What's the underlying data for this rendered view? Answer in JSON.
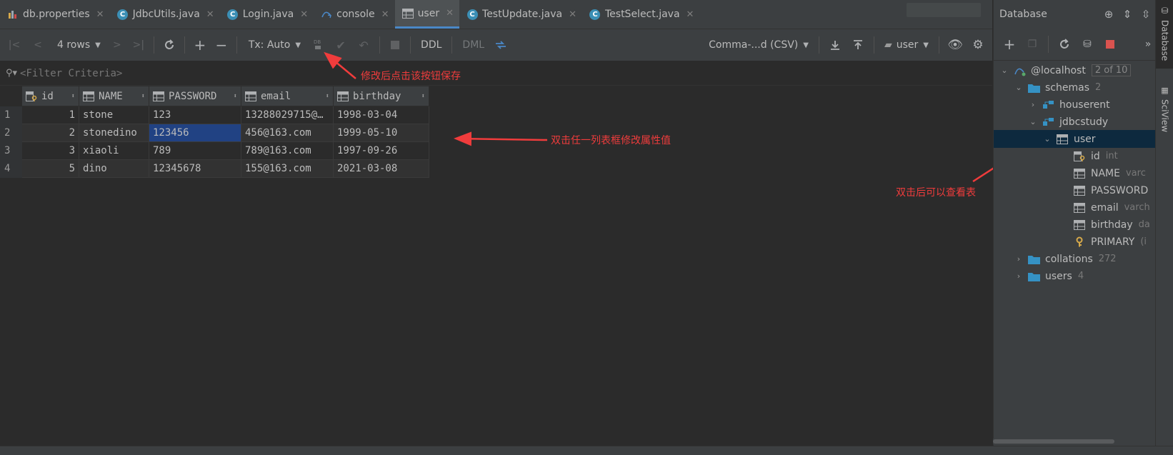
{
  "tabs": [
    {
      "label": "db.properties",
      "icon": "properties-file-icon",
      "active": false
    },
    {
      "label": "JdbcUtils.java",
      "icon": "java-class-icon",
      "active": false
    },
    {
      "label": "Login.java",
      "icon": "java-class-icon",
      "active": false
    },
    {
      "label": "console",
      "icon": "mysql-console-icon",
      "active": false
    },
    {
      "label": "user",
      "icon": "table-icon",
      "active": true
    },
    {
      "label": "TestUpdate.java",
      "icon": "java-class-icon",
      "active": false
    },
    {
      "label": "TestSelect.java",
      "icon": "java-class-icon",
      "active": false
    }
  ],
  "toolbar": {
    "rows_label": "4 rows",
    "tx_label": "Tx: Auto",
    "ddl_label": "DDL",
    "dml_label": "DML",
    "export_label": "Comma-...d (CSV)",
    "datasource_label": "user"
  },
  "filter": {
    "placeholder": "<Filter Criteria>"
  },
  "grid": {
    "columns": [
      {
        "name": "id",
        "icon": "primary-key-column-icon"
      },
      {
        "name": "NAME",
        "icon": "column-icon"
      },
      {
        "name": "PASSWORD",
        "icon": "column-icon"
      },
      {
        "name": "email",
        "icon": "column-icon"
      },
      {
        "name": "birthday",
        "icon": "column-icon"
      }
    ],
    "rows": [
      {
        "num": "1",
        "id": "1",
        "name": "stone",
        "password": "123",
        "email": "13288029715@…",
        "birthday": "1998-03-04"
      },
      {
        "num": "2",
        "id": "2",
        "name": "stonedino",
        "password": "123456",
        "email": "456@163.com",
        "birthday": "1999-05-10"
      },
      {
        "num": "3",
        "id": "3",
        "name": "xiaoli",
        "password": "789",
        "email": "789@163.com",
        "birthday": "1997-09-26"
      },
      {
        "num": "4",
        "id": "5",
        "name": "dino",
        "password": "12345678",
        "email": "155@163.com",
        "birthday": "2021-03-08"
      }
    ],
    "selected_cell": "row 2 PASSWORD"
  },
  "annotations": {
    "save_hint": "修改后点击该按钮保存",
    "edit_hint": "双击任一列表框修改属性值",
    "view_hint": "双击后可以查看表"
  },
  "database_panel": {
    "title": "Database",
    "tree": {
      "host": {
        "label": "@localhost",
        "count": "2 of 10"
      },
      "schemas": {
        "label": "schemas",
        "count": "2"
      },
      "houserent": {
        "label": "houserent"
      },
      "jdbcstudy": {
        "label": "jdbcstudy"
      },
      "user": {
        "label": "user"
      },
      "columns": [
        {
          "label": "id",
          "type": "int"
        },
        {
          "label": "NAME",
          "type": "varc"
        },
        {
          "label": "PASSWORD",
          "type": ""
        },
        {
          "label": "email",
          "type": "varch"
        },
        {
          "label": "birthday",
          "type": "da"
        }
      ],
      "primary": {
        "label": "PRIMARY",
        "type": "(i"
      },
      "collations": {
        "label": "collations",
        "count": "272"
      },
      "users": {
        "label": "users",
        "count": "4"
      }
    }
  },
  "side_tabs": {
    "database": "Database",
    "sciview": "SciView"
  },
  "colors": {
    "accent": "#4a88c7",
    "selection": "#214283",
    "annotation": "#f03c3c",
    "background": "#2b2b2b"
  }
}
